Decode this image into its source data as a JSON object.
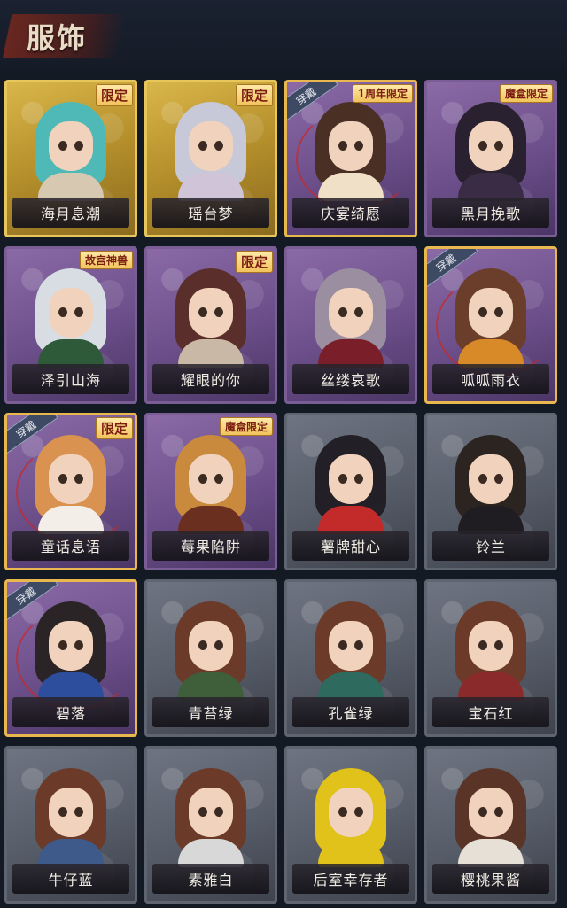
{
  "header": {
    "title": "服饰"
  },
  "cards": [
    {
      "name": "海月息潮",
      "tag": "限定",
      "style": "gold",
      "equipped": false,
      "hair": "#4fb9b8",
      "outfit": "#d7c9b1"
    },
    {
      "name": "瑶台梦",
      "tag": "限定",
      "style": "gold",
      "equipped": false,
      "hair": "#c7c9d8",
      "outfit": "#d0c5d8"
    },
    {
      "name": "庆宴绮愿",
      "tag": "1周年限定",
      "style": "purple",
      "equipped": true,
      "hair": "#4a3024",
      "outfit": "#f0e0c8"
    },
    {
      "name": "黑月挽歌",
      "tag": "魔盒限定",
      "style": "purple",
      "equipped": false,
      "hair": "#2a2130",
      "outfit": "#3a2c44"
    },
    {
      "name": "泽引山海",
      "tag": "故宫神兽",
      "style": "purple",
      "equipped": false,
      "hair": "#d8dde4",
      "outfit": "#2f5a3a"
    },
    {
      "name": "耀眼的你",
      "tag": "限定",
      "style": "purple",
      "equipped": false,
      "hair": "#5a2e2a",
      "outfit": "#c9b8a6"
    },
    {
      "name": "丝缕哀歌",
      "tag": "",
      "style": "purple",
      "equipped": false,
      "hair": "#9a8ea0",
      "outfit": "#7a1f2a"
    },
    {
      "name": "呱呱雨衣",
      "tag": "",
      "style": "purple",
      "equipped": true,
      "hair": "#6a3e2a",
      "outfit": "#d98a28"
    },
    {
      "name": "童话息语",
      "tag": "限定",
      "style": "purple",
      "equipped": true,
      "hair": "#d9924f",
      "outfit": "#f3efe8"
    },
    {
      "name": "莓果陷阱",
      "tag": "魔盒限定",
      "style": "purple",
      "equipped": false,
      "hair": "#c98a3e",
      "outfit": "#6b2f1f"
    },
    {
      "name": "薯牌甜心",
      "tag": "",
      "style": "grey",
      "equipped": false,
      "hair": "#222026",
      "outfit": "#c32a2a"
    },
    {
      "name": "铃兰",
      "tag": "",
      "style": "grey",
      "equipped": false,
      "hair": "#2b2420",
      "outfit": "#1f1c22"
    },
    {
      "name": "碧落",
      "tag": "",
      "style": "purple",
      "equipped": true,
      "hair": "#2a2426",
      "outfit": "#2d4e9c"
    },
    {
      "name": "青苔绿",
      "tag": "",
      "style": "grey",
      "equipped": false,
      "hair": "#6b3a28",
      "outfit": "#3f5e3a"
    },
    {
      "name": "孔雀绿",
      "tag": "",
      "style": "grey",
      "equipped": false,
      "hair": "#6b3a28",
      "outfit": "#2f6a5e"
    },
    {
      "name": "宝石红",
      "tag": "",
      "style": "grey",
      "equipped": false,
      "hair": "#6b3a28",
      "outfit": "#8b2a2a"
    },
    {
      "name": "牛仔蓝",
      "tag": "",
      "style": "grey",
      "equipped": false,
      "hair": "#6b3a28",
      "outfit": "#3d5a8a"
    },
    {
      "name": "素雅白",
      "tag": "",
      "style": "grey",
      "equipped": false,
      "hair": "#6b3a28",
      "outfit": "#d8d8d8"
    },
    {
      "name": "后室幸存者",
      "tag": "",
      "style": "grey",
      "equipped": false,
      "hair": "#e0c21a",
      "outfit": "#e0c21a"
    },
    {
      "name": "樱桃果酱",
      "tag": "",
      "style": "grey",
      "equipped": false,
      "hair": "#5a3426",
      "outfit": "#e6e0d6"
    }
  ],
  "equip_label": "穿戴"
}
